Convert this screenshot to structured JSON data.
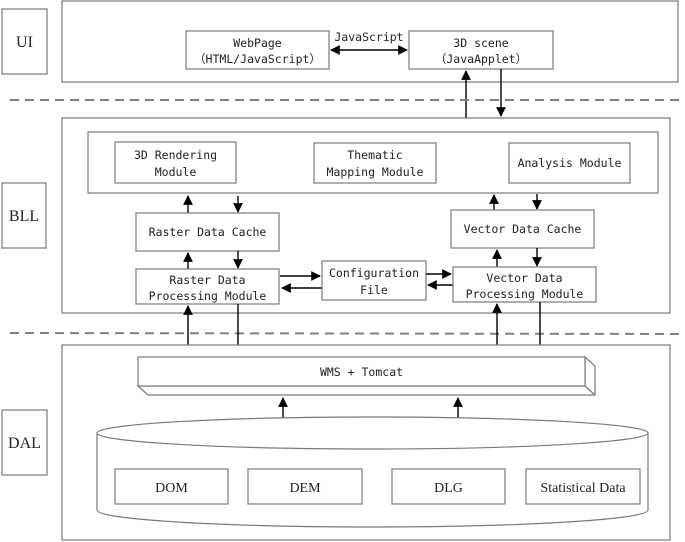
{
  "layers": {
    "ui": {
      "label": "UI"
    },
    "bll": {
      "label": "BLL"
    },
    "dal": {
      "label": "DAL"
    }
  },
  "ui_layer": {
    "webpage": {
      "line1": "WebPage",
      "line2": "（HTML/JavaScript）"
    },
    "scene": {
      "line1": "3D scene",
      "line2": "（JavaApplet）"
    },
    "connector_label": "JavaScript"
  },
  "bll_layer": {
    "rendering": {
      "line1": "3D Rendering",
      "line2": "Module"
    },
    "thematic": {
      "line1": "Thematic",
      "line2": "Mapping Module"
    },
    "analysis": {
      "line1": "Analysis Module"
    },
    "raster_cache": {
      "line1": "Raster Data Cache"
    },
    "vector_cache": {
      "line1": "Vector Data Cache"
    },
    "raster_processing": {
      "line1": "Raster Data",
      "line2": "Processing Module"
    },
    "config": {
      "line1": "Configuration",
      "line2": "File"
    },
    "vector_processing": {
      "line1": "Vector Data",
      "line2": "Processing Module"
    }
  },
  "dal_layer": {
    "server": {
      "label": "WMS + Tomcat"
    },
    "datasets": [
      {
        "label": "DOM"
      },
      {
        "label": "DEM"
      },
      {
        "label": "DLG"
      },
      {
        "label": "Statistical Data"
      }
    ]
  }
}
